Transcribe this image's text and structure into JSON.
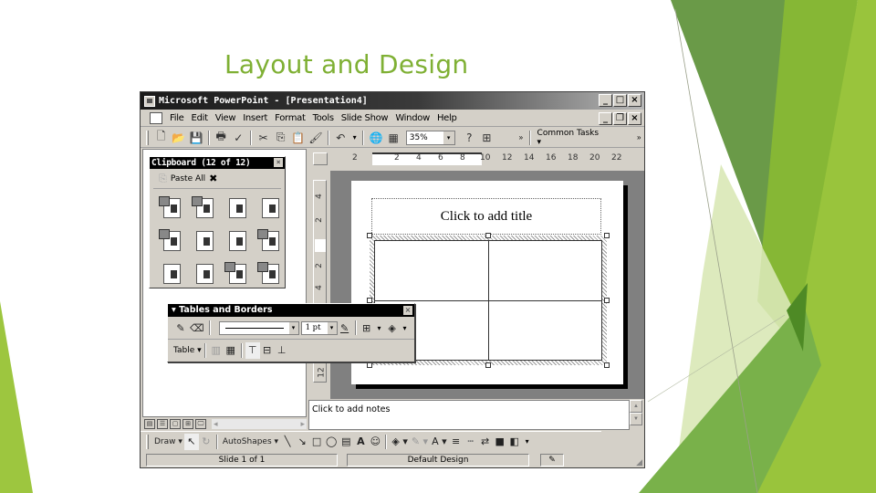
{
  "slide": {
    "title": "Layout and Design",
    "colors": {
      "title": "#7fb034",
      "accent_dark": "#5d8f2c",
      "accent_mid": "#7cb342",
      "accent_light": "#9ec93c",
      "accent_pale": "#d9e8b6"
    }
  },
  "window": {
    "title": "Microsoft PowerPoint - [Presentation4]",
    "caption_buttons": {
      "minimize": "_",
      "maximize": "□",
      "close": "×"
    },
    "doc_caption_buttons": {
      "minimize": "_",
      "restore": "❐",
      "close": "×"
    }
  },
  "menubar": {
    "items": [
      {
        "label": "File",
        "icon": "file-menu"
      },
      {
        "label": "Edit"
      },
      {
        "label": "View"
      },
      {
        "label": "Insert"
      },
      {
        "label": "Format"
      },
      {
        "label": "Tools"
      },
      {
        "label": "Slide Show"
      },
      {
        "label": "Window"
      },
      {
        "label": "Help"
      }
    ]
  },
  "toolbar": {
    "buttons": {
      "new": "🗋",
      "open": "📂",
      "save": "💾",
      "print": "🖶",
      "spelling": "✓",
      "cut": "✂",
      "copy": "⎘",
      "paste": "📋",
      "format_painter": "🖌",
      "undo": "↶",
      "undo_dd": "▾",
      "insert_hyperlink": "🌐",
      "tables": "▦",
      "help": "?",
      "slide_sorter": "⊞",
      "more": "»"
    },
    "zoom_value": "35%",
    "zoom_dd": "▾",
    "common_tasks": "Common Tasks ▾",
    "more2": "»"
  },
  "clipboard": {
    "title": "Clipboard (12 of 12)",
    "close": "×",
    "copy_icon": "⎘",
    "paste_all_label": "Paste All",
    "clear_icon": "✖",
    "items": [
      {
        "type": "ppt-object"
      },
      {
        "type": "ppt-text"
      },
      {
        "type": "object"
      },
      {
        "type": "object"
      },
      {
        "type": "ppt-object"
      },
      {
        "type": "object"
      },
      {
        "type": "object"
      },
      {
        "type": "ppt-object"
      },
      {
        "type": "object"
      },
      {
        "type": "object"
      },
      {
        "type": "ppt-object"
      },
      {
        "type": "ppt-text"
      }
    ]
  },
  "tables_and_borders": {
    "title": "▾ Tables and Borders",
    "close": "×",
    "draw_table": "✎",
    "eraser": "⌫",
    "line_style_dd": "▾",
    "line_weight": "1 pt",
    "line_weight_dd": "▾",
    "border_color": "✎",
    "borders": "⊞",
    "borders_dd": "▾",
    "fill_color": "◈",
    "fill_dd": "▾",
    "table_menu": "Table ▾",
    "merge_cells": "▥",
    "split_cells": "▦",
    "align_top": "⊤",
    "center_vertically": "⊟",
    "align_bottom": "⊥"
  },
  "rulers": {
    "horizontal": [
      "2",
      "2",
      "4",
      "6",
      "8",
      "10",
      "12",
      "14",
      "16",
      "18",
      "20",
      "22"
    ],
    "vertical": [
      "4",
      "2",
      "2",
      "4",
      "12"
    ]
  },
  "slide_canvas": {
    "title_placeholder": "Click to add title",
    "table": {
      "rows": 2,
      "cols": 2
    }
  },
  "notes": {
    "placeholder": "Click to add notes",
    "scroll_up": "▲",
    "scroll_down": "▼"
  },
  "view_buttons": [
    "▤",
    "☰",
    "▢",
    "⊞",
    "🖵"
  ],
  "scroll_left": "◂",
  "scroll_right": "▸",
  "drawbar": {
    "draw": "Draw ▾",
    "select": "↖",
    "rotate": "↻",
    "autoshapes": "AutoShapes ▾",
    "line": "╲",
    "arrow": "↘",
    "rectangle": "□",
    "oval": "◯",
    "textbox": "▤",
    "wordart": "A",
    "clipart": "☺",
    "fill_color": "◈ ▾",
    "line_color": "✎ ▾",
    "font_color": "A ▾",
    "line_style": "≡",
    "dash_style": "┅",
    "arrow_style": "⇄",
    "shadow": "■",
    "threed": "◧",
    "more": "▾"
  },
  "statusbar": {
    "slide": "Slide 1 of 1",
    "design": "Default Design",
    "spell_icon": "✎",
    "grip": "◢"
  }
}
